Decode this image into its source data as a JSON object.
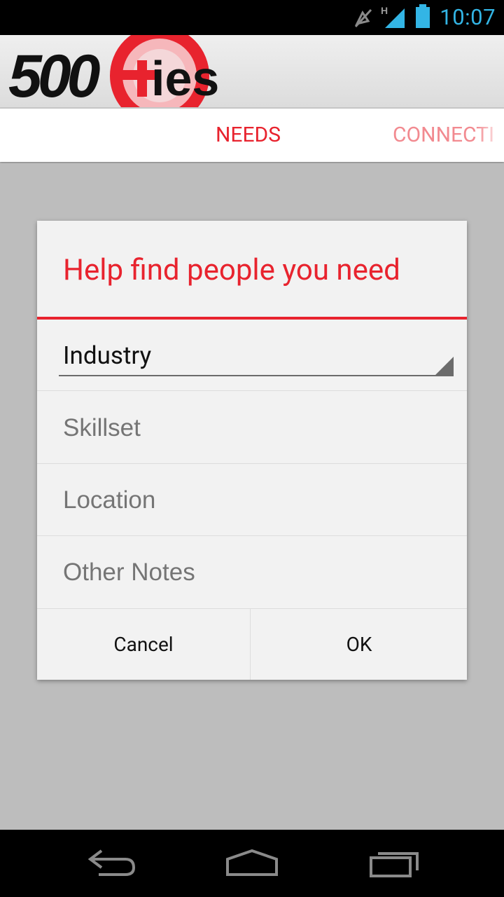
{
  "status_bar": {
    "time": "10:07",
    "network_label": "H",
    "icons": [
      "silent-mode-icon",
      "signal-icon",
      "battery-icon"
    ],
    "accent_color": "#33b5e5"
  },
  "header": {
    "logo_text_main": "500",
    "logo_text_suffix": "ies",
    "brand_color": "#e8232e"
  },
  "tabs": [
    {
      "label": "NEEDS"
    },
    {
      "label": "CONNECTI"
    }
  ],
  "dialog": {
    "title": "Help find people you need",
    "spinner_value": "Industry",
    "fields": [
      {
        "placeholder": "Skillset"
      },
      {
        "placeholder": "Location"
      },
      {
        "placeholder": "Other Notes"
      }
    ],
    "cancel_label": "Cancel",
    "ok_label": "OK"
  },
  "nav": {
    "icons": [
      "back-icon",
      "home-icon",
      "recent-apps-icon"
    ]
  }
}
